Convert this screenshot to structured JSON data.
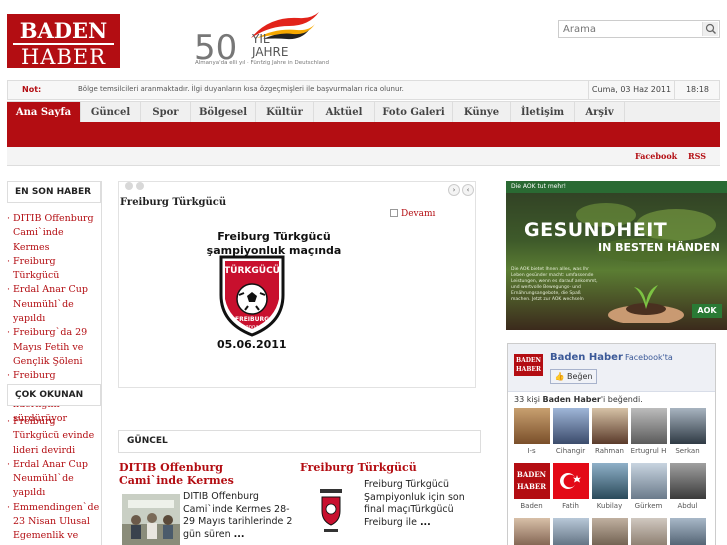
{
  "header": {
    "logo_line1": "BADEN",
    "logo_line2": "HABER",
    "anniversary": {
      "number": "50",
      "yil": "YIL",
      "jahre": "JAHRE",
      "tagline": "Almanya'da elli yıl · Fünfzig Jahre in Deutschland"
    },
    "search_placeholder": "Arama"
  },
  "ticker": {
    "label": "Not:",
    "message": "Bölge temsilcileri aranmaktadır. İlgi duyanların kısa özgeçmişleri ile başvurmaları rica olunur.",
    "date": "Cuma, 03 Haz 2011",
    "time": "18:18"
  },
  "nav": {
    "items": [
      "Ana Sayfa",
      "Güncel",
      "Spor",
      "Bölgesel",
      "Kültür",
      "Aktüel",
      "Foto Galeri",
      "Künye",
      "İletişim",
      "Arşiv"
    ],
    "active_index": 0
  },
  "social": {
    "facebook": "Facebook",
    "rss": "RSS"
  },
  "left": {
    "latest_title": "EN SON HABER",
    "latest_items": [
      "DITIB Offenburg Cami`inde Kermes",
      "Freiburg Türkgücü",
      "Erdal Anar Cup Neumühl`de yapıldı",
      "Freiburg`da 29 Mayıs Fetih ve Gençlik Şöleni",
      "Freiburg Türkgücü liderliğini sürdürüyor"
    ],
    "popular_title": "ÇOK OKUNAN",
    "popular_items": [
      "Freiburg Türkgücü evinde lideri devirdi",
      "Erdal Anar Cup Neumühl`de yapıldı",
      "Emmendingen`de 23 Nisan Ulusal Egemenlik ve"
    ]
  },
  "slider": {
    "title": "Freiburg Türkgücü",
    "more": "Devamı",
    "poster_line1": "Freiburg Türkgücü",
    "poster_line2": "şampiyonluk maçında",
    "crest_top": "TÜRKGÜCÜ",
    "crest_bottom": "FREIBURG",
    "crest_year": "2004",
    "poster_date": "05.06.2011",
    "prev": "‹",
    "next": "›"
  },
  "guncel": {
    "title": "GÜNCEL",
    "items": [
      {
        "title": "DITIB Offenburg Cami`inde Kermes",
        "desc": "DITIB Offenburg Cami`inde Kermes 28-29 Mayıs tarihlerinde 2 gün süren",
        "more": "..."
      },
      {
        "title": "Freiburg Türkgücü",
        "desc": "Freiburg Türkgücü Şampiyonluk için son final maçıTürkgücü Freiburg ile",
        "more": "..."
      }
    ]
  },
  "ad": {
    "top": "Die AOK tut mehr!",
    "line1": "GESUNDHEIT",
    "line2": "IN BESTEN HÄNDEN",
    "body": "Die AOK bietet Ihnen alles, was Ihr Leben gesünder macht: umfassende Leistungen, wenn es darauf ankommt, und wertvolle Bewegungs- und Ernährungsangebote, die Spaß machen. Jetzt zur AOK wechseln",
    "brand": "AOK"
  },
  "facebook_box": {
    "logo_line1": "BADEN",
    "logo_line2": "HABER",
    "page_name": "Baden Haber",
    "on_facebook": "Facebook'ta",
    "like_label": "Beğen",
    "count_pre": "33 kişi ",
    "count_name": "Baden Haber",
    "count_post": "'i beğendi.",
    "people": [
      "I-s",
      "Cihangir",
      "Rahman",
      "Ertugrul H",
      "Serkan",
      "Baden",
      "Fatih",
      "Kubilay",
      "Gürkem",
      "Abdul"
    ]
  }
}
